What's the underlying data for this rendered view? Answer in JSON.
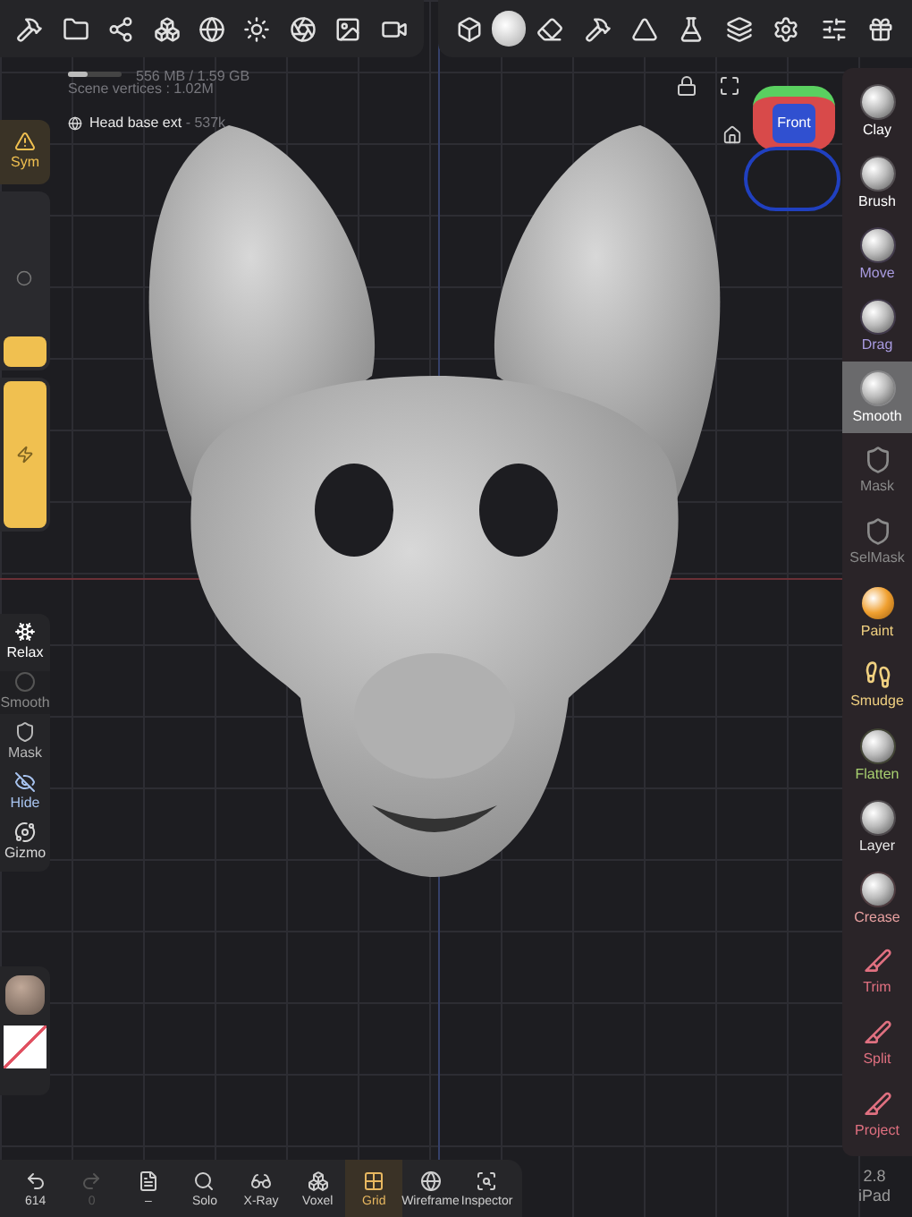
{
  "stats": {
    "memory": "556 MB / 1.59 GB",
    "memory_bar": {
      "level": 0.35
    },
    "vertices": "Scene vertices : 1.02M",
    "mesh_name": "Head base ext",
    "mesh_count": " - 537k"
  },
  "view_cube": {
    "label": "Front"
  },
  "symmetry": {
    "label": "Sym",
    "on": true
  },
  "left_sliders": [
    {
      "kind": "radius",
      "level": 0.18
    },
    {
      "kind": "intensity",
      "level": 1.0
    }
  ],
  "left_tools": [
    {
      "label": "Relax",
      "disabled": false,
      "color": "#ffffff"
    },
    {
      "label": "Smooth",
      "disabled": true,
      "color": "#8a8a8a"
    },
    {
      "label": "Mask",
      "disabled": false,
      "color": "#b8b8b8"
    },
    {
      "label": "Hide",
      "disabled": false,
      "color": "#a8c4f0"
    },
    {
      "label": "Gizmo",
      "disabled": false,
      "color": "#d8d8d8"
    }
  ],
  "right_tools": [
    {
      "label": "Clay",
      "selected": false,
      "color": "#ffffff",
      "kind": "sphere"
    },
    {
      "label": "Brush",
      "selected": false,
      "color": "#ffffff",
      "kind": "sphere"
    },
    {
      "label": "Move",
      "selected": false,
      "color": "#a99be0",
      "kind": "sphere"
    },
    {
      "label": "Drag",
      "selected": false,
      "color": "#a99be0",
      "kind": "sphere"
    },
    {
      "label": "Smooth",
      "selected": true,
      "color": "#ffffff",
      "kind": "sphere"
    },
    {
      "label": "Mask",
      "selected": false,
      "color": "#8a8a8a",
      "kind": "shield"
    },
    {
      "label": "SelMask",
      "selected": false,
      "color": "#8a8a8a",
      "kind": "shield"
    },
    {
      "label": "Paint",
      "selected": false,
      "color": "#f0d080",
      "kind": "paint"
    },
    {
      "label": "Smudge",
      "selected": false,
      "color": "#f0d080",
      "kind": "smudge"
    },
    {
      "label": "Flatten",
      "selected": false,
      "color": "#a8d070",
      "kind": "sphere"
    },
    {
      "label": "Layer",
      "selected": false,
      "color": "#e8e8e8",
      "kind": "sphere"
    },
    {
      "label": "Crease",
      "selected": false,
      "color": "#e8a0a0",
      "kind": "sphere"
    },
    {
      "label": "Trim",
      "selected": false,
      "color": "#e07080",
      "kind": "cut"
    },
    {
      "label": "Split",
      "selected": false,
      "color": "#e07080",
      "kind": "cut"
    },
    {
      "label": "Project",
      "selected": false,
      "color": "#e07080",
      "kind": "cut"
    }
  ],
  "bottom_toolbar": [
    {
      "label": "614",
      "kind": "undo",
      "selected": false,
      "disabled": false
    },
    {
      "label": "0",
      "kind": "redo",
      "selected": false,
      "disabled": true
    },
    {
      "label": "–",
      "kind": "doc",
      "selected": false,
      "disabled": false
    },
    {
      "label": "Solo",
      "kind": "search",
      "selected": false,
      "disabled": false
    },
    {
      "label": "X-Ray",
      "kind": "glasses",
      "selected": false,
      "disabled": false
    },
    {
      "label": "Voxel",
      "kind": "voxel",
      "selected": false,
      "disabled": false
    },
    {
      "label": "Grid",
      "kind": "grid",
      "selected": true,
      "disabled": false
    },
    {
      "label": "Wireframe",
      "kind": "wire",
      "selected": false,
      "disabled": false
    },
    {
      "label": "Inspector",
      "kind": "inspect",
      "selected": false,
      "disabled": false
    }
  ],
  "version": {
    "number": "2.8",
    "device": "iPad"
  }
}
